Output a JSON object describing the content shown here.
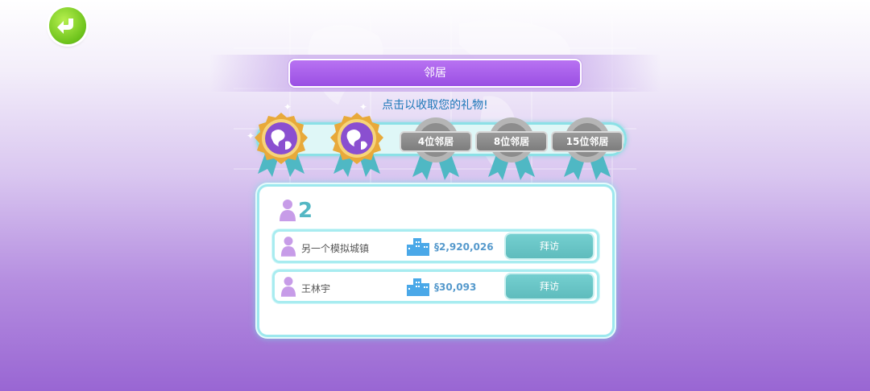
{
  "header": {
    "title": "邻居",
    "hint": "点击以收取您的礼物!"
  },
  "rewards": [
    {
      "state": "unlocked",
      "label": ""
    },
    {
      "state": "unlocked",
      "label": ""
    },
    {
      "state": "locked",
      "label": "4位邻居"
    },
    {
      "state": "locked",
      "label": "8位邻居"
    },
    {
      "state": "locked",
      "label": "15位邻居"
    }
  ],
  "neighbors": {
    "count": "2",
    "items": [
      {
        "name": "另一个模拟城镇",
        "value": "§2,920,026",
        "action": "拜访"
      },
      {
        "name": "王林宇",
        "value": "§30,093",
        "action": "拜访"
      }
    ]
  },
  "icons": {
    "back": "back-arrow-icon",
    "person": "person-icon",
    "city": "city-icon",
    "medal": "globe-medal-icon"
  },
  "colors": {
    "accent": "#9a4fe3",
    "visit_button": "#5fbcbd",
    "back_button": "#6cc21b",
    "count": "#54b7c4"
  }
}
